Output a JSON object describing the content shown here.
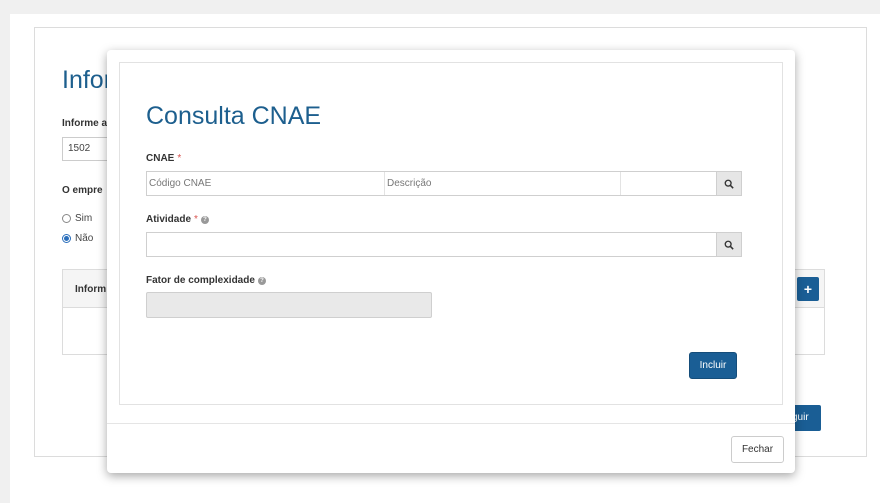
{
  "background": {
    "title_fragment": "Infor",
    "label_fragment": "Informe a",
    "input_value": "1502",
    "question_fragment": "O empre",
    "radio_sim": "Sim",
    "radio_nao": "Não",
    "table_header_fragment": "Inform",
    "plus_label": "+",
    "next_fragment": "guir"
  },
  "modal": {
    "title": "Consulta CNAE",
    "cnae": {
      "label": "CNAE",
      "required_mark": "*",
      "codigo_placeholder": "Código CNAE",
      "descricao_placeholder": "Descrição"
    },
    "atividade": {
      "label": "Atividade",
      "required_mark": "*",
      "value": ""
    },
    "fator": {
      "label": "Fator de complexidade",
      "value": ""
    },
    "incluir_label": "Incluir",
    "fechar_label": "Fechar"
  },
  "colors": {
    "primary": "#1a5e95",
    "title": "#1d5f8e",
    "required": "#d9534f"
  }
}
